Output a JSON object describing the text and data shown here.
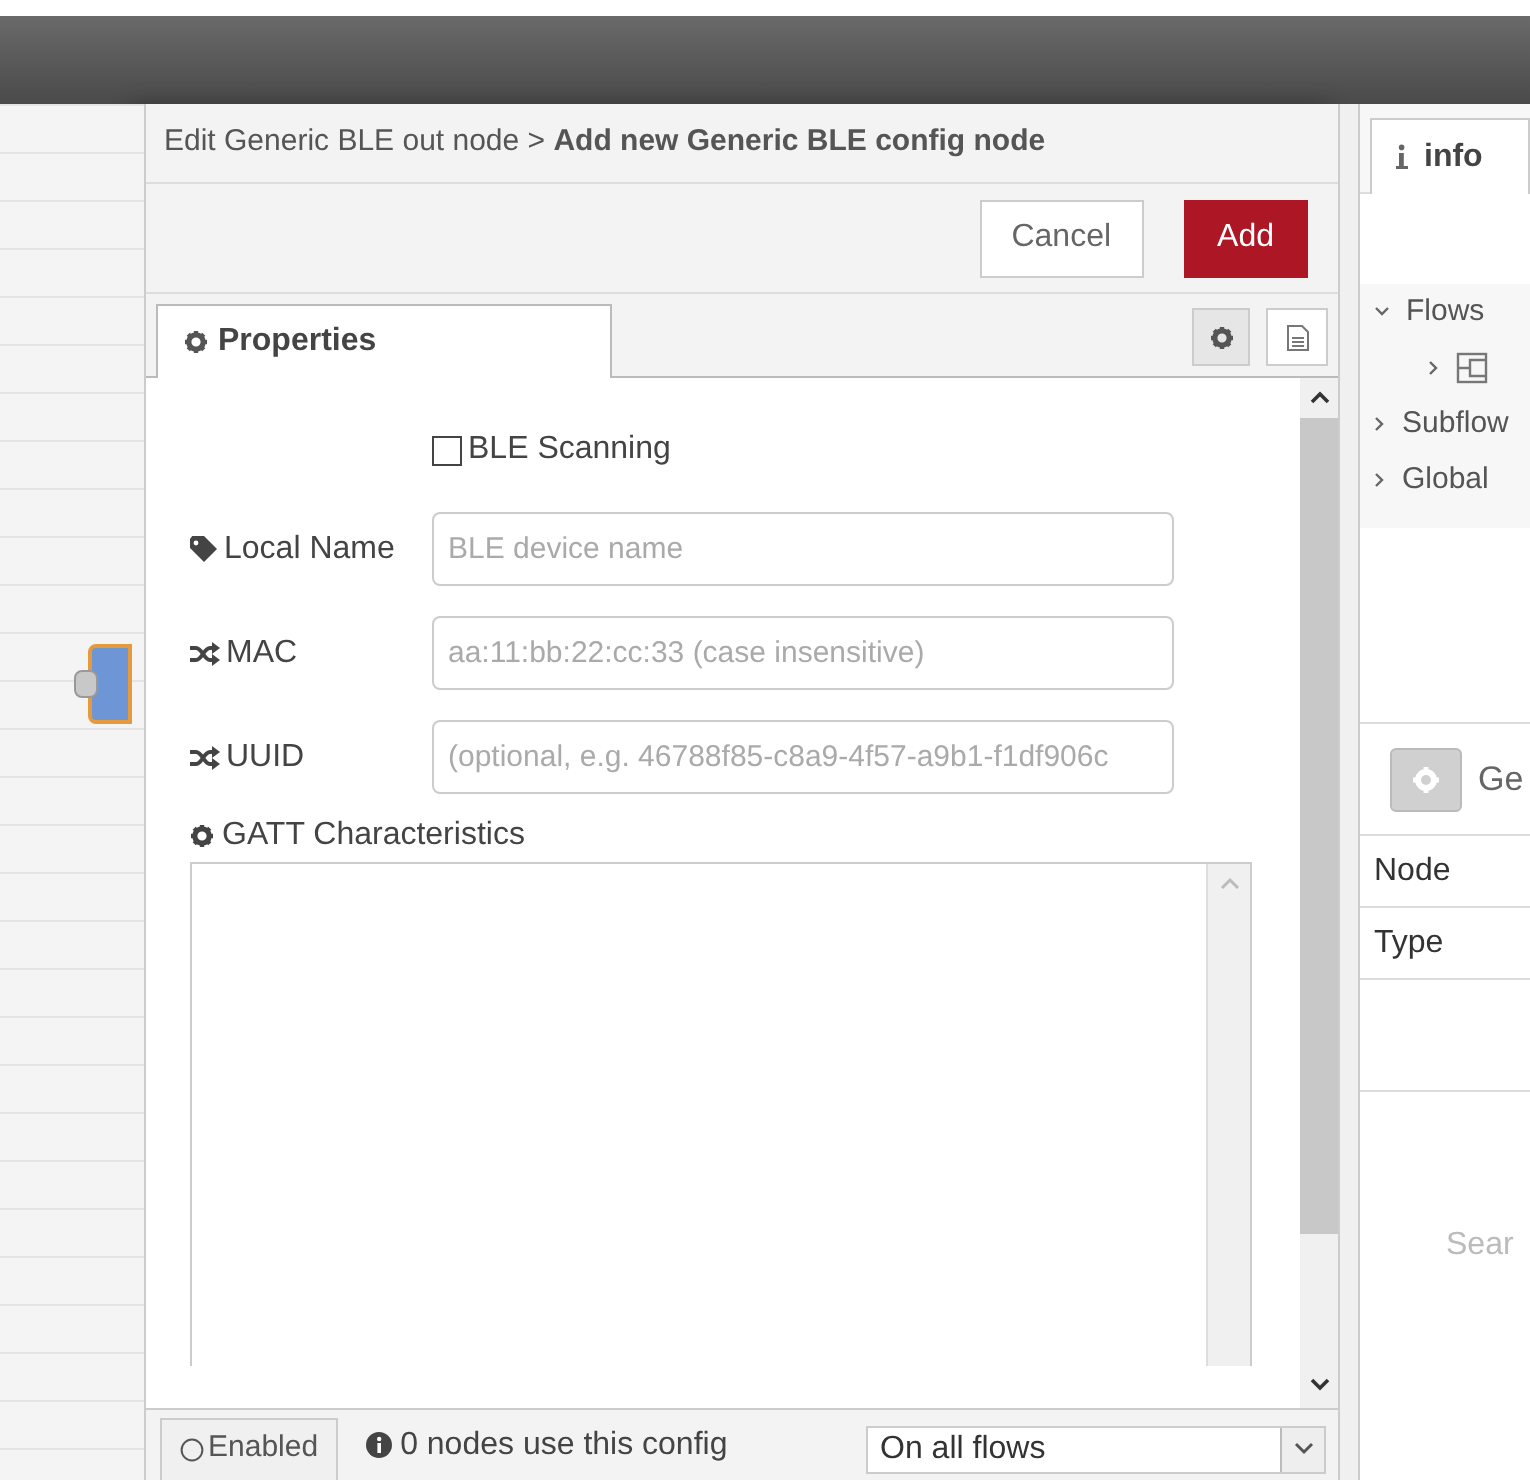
{
  "dialog": {
    "title": "Edit Generic BLE out node > **Add new Generic BLE config node**",
    "buttons": [
      {
        "label": "Cancel",
        "kind": "secondary"
      },
      {
        "label": "Add",
        "kind": "primary"
      }
    ],
    "tabs": [
      {
        "label": "Properties",
        "selected": true
      }
    ],
    "ble_scanning": {
      "label": "BLE Scanning",
      "checked": false
    },
    "fields": [
      {
        "label": "Local Name",
        "kind": "tag",
        "placeholder": "BLE device name"
      },
      {
        "label": "MAC",
        "kind": "shuffle",
        "placeholder": "aa:11:bb:22:cc:33 (case insensitive)"
      },
      {
        "label": "UUID",
        "kind": "shuffle",
        "placeholder": "(optional, e.g. 46788f85-c8a9-4f57-a9b1-f1df906c"
      }
    ],
    "gatt": {
      "label": "GATT Characteristics"
    },
    "footer": {
      "enabled": {
        "label": "Enabled",
        "on": false
      },
      "usage": "0 nodes use this config",
      "scope": "On all flows"
    }
  },
  "sidebar": {
    "tab": {
      "label": "info",
      "selected": true
    },
    "tree": [
      {
        "label": "Flows",
        "expanded": true,
        "children": [
          {
            "kind": "flow",
            "expanded": false
          }
        ]
      },
      {
        "label": "Subflow",
        "expanded": false
      },
      {
        "label": "Global",
        "expanded": false
      }
    ],
    "section": {
      "title": "Ge"
    },
    "properties": [
      "Node",
      "Type"
    ],
    "search_hint": "Sear"
  }
}
